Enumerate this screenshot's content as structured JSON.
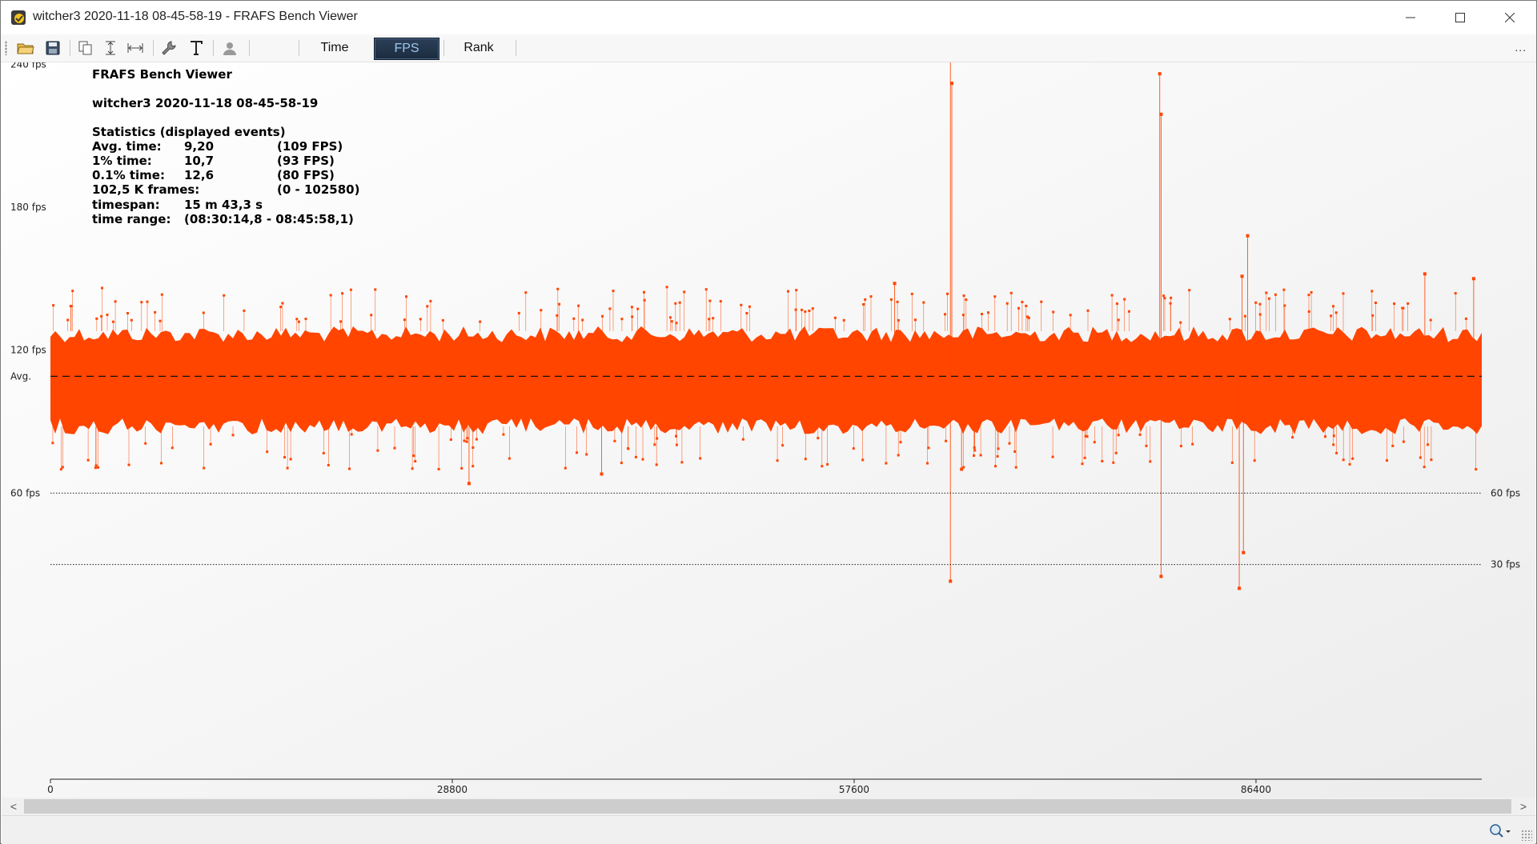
{
  "window": {
    "title": "witcher3 2020-11-18 08-45-58-19 - FRAFS Bench Viewer"
  },
  "toolbar": {
    "icons": [
      "open-folder-icon",
      "save-icon",
      "copy-icon",
      "fit-vertical-icon",
      "fit-horizontal-icon",
      "wrench-icon",
      "text-icon",
      "user-icon"
    ],
    "tabs": {
      "time": "Time",
      "fps": "FPS",
      "rank": "Rank"
    },
    "active_tab": "FPS",
    "overflow": "..."
  },
  "stats": {
    "app": "FRAFS Bench Viewer",
    "file": "witcher3 2020-11-18 08-45-58-19",
    "header": "Statistics (displayed events)",
    "rows": [
      {
        "label": "Avg. time:",
        "value": "9,20",
        "extra": "(109 FPS)"
      },
      {
        "label": "1% time:",
        "value": "10,7",
        "extra": "(93 FPS)"
      },
      {
        "label": "0.1% time:",
        "value": "12,6",
        "extra": "(80 FPS)"
      },
      {
        "label": "102,5 K frames:",
        "value": "",
        "extra": "(0 - 102580)"
      },
      {
        "label": "timespan:",
        "value": "15 m 43,3 s",
        "extra": ""
      },
      {
        "label": "time range:",
        "value": "(08:30:14,8 - 08:45:58,1)",
        "extra": ""
      }
    ]
  },
  "chart_data": {
    "type": "scatter",
    "series_color": "#ff4500",
    "avg_label": "Avg.",
    "avg_fps": 109,
    "y_ticks": [
      {
        "value": 240,
        "label": "240 fps"
      },
      {
        "value": 180,
        "label": "180 fps"
      },
      {
        "value": 120,
        "label": "120 fps"
      },
      {
        "value": 60,
        "label": "60 fps"
      }
    ],
    "ref_lines": [
      {
        "value": 60,
        "label": "60 fps"
      },
      {
        "value": 30,
        "label": "30 fps"
      }
    ],
    "x_ticks": [
      {
        "value": 0,
        "label": "0"
      },
      {
        "value": 28800,
        "label": "28800"
      },
      {
        "value": 57600,
        "label": "57600"
      },
      {
        "value": 86400,
        "label": "86400"
      }
    ],
    "xlim": [
      0,
      102580
    ],
    "ylim": [
      0,
      248
    ],
    "band": {
      "low": 88,
      "high": 128
    },
    "spikes_high": [
      {
        "x": 64500,
        "fps": 246
      },
      {
        "x": 64600,
        "fps": 232
      },
      {
        "x": 79500,
        "fps": 236
      },
      {
        "x": 79600,
        "fps": 219
      },
      {
        "x": 85400,
        "fps": 151
      },
      {
        "x": 85800,
        "fps": 168
      },
      {
        "x": 60500,
        "fps": 148
      },
      {
        "x": 98500,
        "fps": 152
      },
      {
        "x": 102000,
        "fps": 150
      }
    ],
    "spikes_low": [
      {
        "x": 64500,
        "fps": 23
      },
      {
        "x": 79600,
        "fps": 25
      },
      {
        "x": 85200,
        "fps": 20
      },
      {
        "x": 85500,
        "fps": 35
      },
      {
        "x": 30000,
        "fps": 64
      },
      {
        "x": 39500,
        "fps": 68
      },
      {
        "x": 65300,
        "fps": 70
      }
    ]
  },
  "scrollbar": {
    "left_arrow": "<",
    "right_arrow": ">"
  }
}
